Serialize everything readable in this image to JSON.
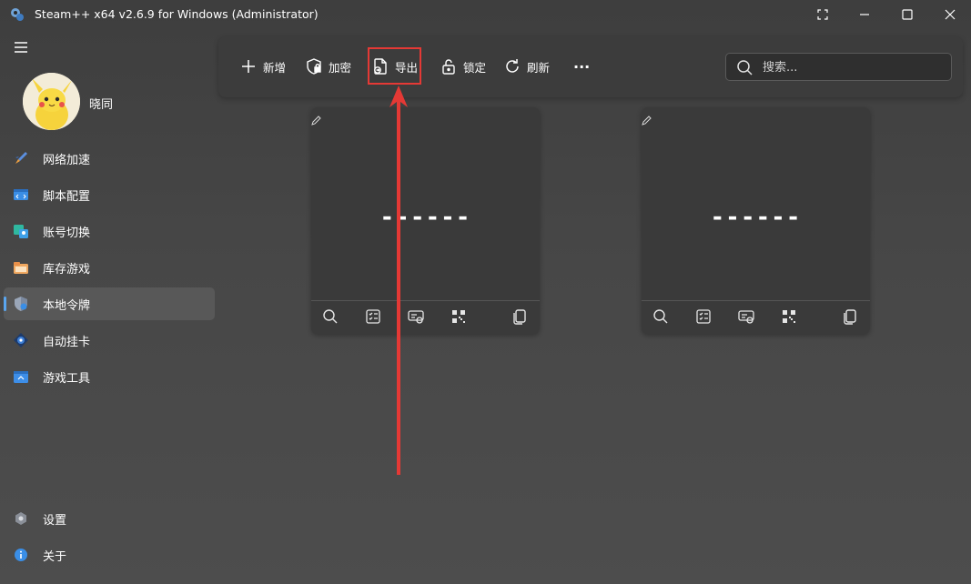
{
  "window": {
    "title": "Steam++ x64 v2.6.9 for Windows (Administrator)",
    "controls": [
      "fullscreen-icon",
      "minimize-icon",
      "maximize-icon",
      "close-icon"
    ]
  },
  "sidebar": {
    "username": "晓同",
    "items": [
      {
        "label": "网络加速",
        "icon": "rocket-icon"
      },
      {
        "label": "脚本配置",
        "icon": "script-icon"
      },
      {
        "label": "账号切换",
        "icon": "account-switch-icon"
      },
      {
        "label": "库存游戏",
        "icon": "library-icon"
      },
      {
        "label": "本地令牌",
        "icon": "shield-token-icon",
        "active": true
      },
      {
        "label": "自动挂卡",
        "icon": "steam-card-icon"
      },
      {
        "label": "游戏工具",
        "icon": "game-tools-icon"
      }
    ],
    "footer": [
      {
        "label": "设置",
        "icon": "gear-icon"
      },
      {
        "label": "关于",
        "icon": "info-icon"
      }
    ]
  },
  "toolbar": {
    "add": "新增",
    "encrypt": "加密",
    "export": "导出",
    "lock": "锁定",
    "refresh": "刷新",
    "more": "···",
    "search_placeholder": "搜索..."
  },
  "cards": [
    {
      "code": "------"
    },
    {
      "code": "------"
    }
  ],
  "colors": {
    "accent": "#5aa6f0",
    "highlight": "#e53935"
  }
}
